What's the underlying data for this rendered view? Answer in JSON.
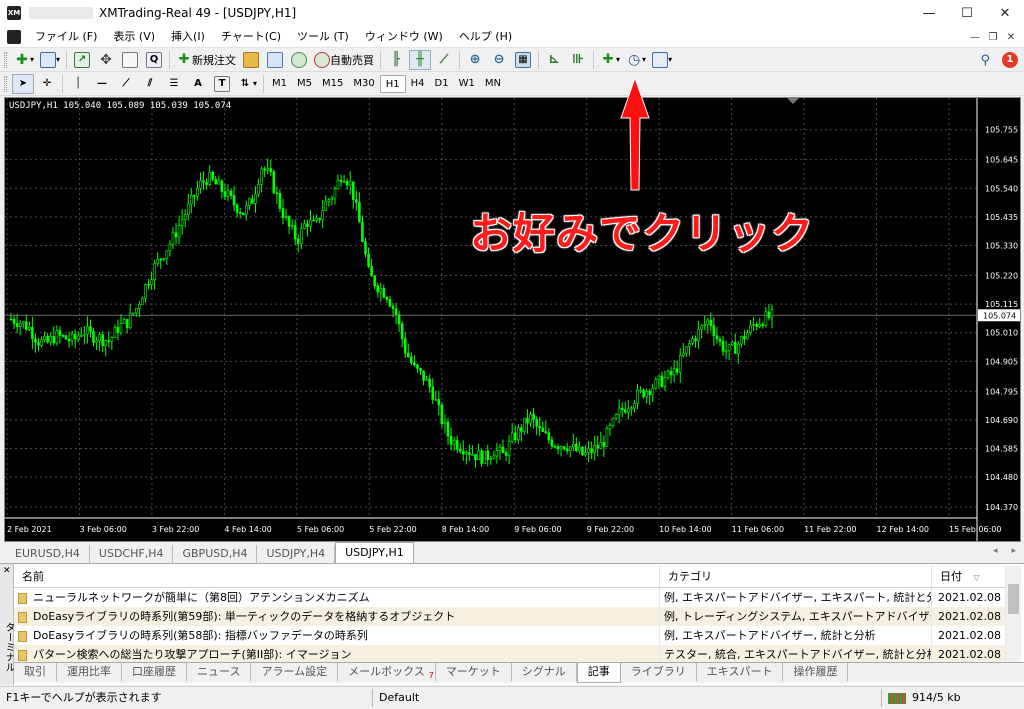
{
  "window": {
    "title": "XMTrading-Real 49 - [USDJPY,H1]",
    "minimize": "—",
    "maximize": "☐",
    "close": "✕"
  },
  "menu": [
    "ファイル (F)",
    "表示 (V)",
    "挿入(I)",
    "チャート(C)",
    "ツール (T)",
    "ウィンドウ (W)",
    "ヘルプ (H)"
  ],
  "toolbar": {
    "new_order": "新規注文",
    "auto_trade": "自動売買"
  },
  "timeframes": [
    "M1",
    "M5",
    "M15",
    "M30",
    "H1",
    "H4",
    "D1",
    "W1",
    "MN"
  ],
  "active_timeframe": "H1",
  "chart": {
    "info": "USDJPY,H1  105.040 105.089 105.039 105.074",
    "current_price": "105.074"
  },
  "chart_data": {
    "type": "candlestick",
    "symbol": "USDJPY",
    "timeframe": "H1",
    "ylim": [
      104.33,
      105.82
    ],
    "y_ticks": [
      "105.755",
      "105.645",
      "105.540",
      "105.435",
      "105.330",
      "105.220",
      "105.115",
      "105.010",
      "104.905",
      "104.795",
      "104.690",
      "104.585",
      "104.480",
      "104.370"
    ],
    "x_ticks": [
      "2 Feb 2021",
      "3 Feb 06:00",
      "3 Feb 22:00",
      "4 Feb 14:00",
      "5 Feb 06:00",
      "5 Feb 22:00",
      "8 Feb 14:00",
      "9 Feb 06:00",
      "9 Feb 22:00",
      "10 Feb 14:00",
      "11 Feb 06:00",
      "11 Feb 22:00",
      "12 Feb 14:00",
      "15 Feb 06:00"
    ],
    "close_series": [
      105.06,
      105.05,
      105.03,
      104.98,
      104.97,
      105.0,
      104.99,
      104.98,
      105.02,
      105.0,
      104.99,
      104.98,
      105.03,
      105.05,
      105.1,
      105.18,
      105.25,
      105.3,
      105.35,
      105.42,
      105.48,
      105.55,
      105.58,
      105.55,
      105.52,
      105.48,
      105.45,
      105.5,
      105.62,
      105.58,
      105.48,
      105.4,
      105.35,
      105.42,
      105.4,
      105.48,
      105.52,
      105.6,
      105.55,
      105.4,
      105.22,
      105.18,
      105.15,
      105.08,
      104.95,
      104.88,
      104.85,
      104.8,
      104.7,
      104.62,
      104.6,
      104.58,
      104.56,
      104.55,
      104.58,
      104.56,
      104.62,
      104.66,
      104.7,
      104.65,
      104.62,
      104.6,
      104.6,
      104.58,
      104.56,
      104.58,
      104.6,
      104.66,
      104.72,
      104.75,
      104.78,
      104.8,
      104.82,
      104.84,
      104.86,
      104.92,
      104.98,
      105.02,
      105.06,
      104.98,
      104.94,
      104.96,
      105.0,
      105.04,
      105.06,
      105.07
    ]
  },
  "overlay_text": "お好みでクリック",
  "chart_tabs": [
    "EURUSD,H4",
    "USDCHF,H4",
    "GBPUSD,H4",
    "USDJPY,H4",
    "USDJPY,H1"
  ],
  "active_chart_tab": "USDJPY,H1",
  "terminal": {
    "side_label": "ターミナル",
    "columns": [
      "名前",
      "カテゴリ",
      "日付"
    ],
    "rows": [
      {
        "name": "ニューラルネットワークが簡単に（第8回）アテンションメカニズム",
        "category": "例, エキスパートアドバイザー, エキスパート, 統計と分析",
        "date": "2021.02.08"
      },
      {
        "name": "DoEasyライブラリの時系列(第59部): 単一ティックのデータを格納するオブジェクト",
        "category": "例, トレーディングシステム, エキスパートアドバイザー, 統計と分析",
        "date": "2021.02.08"
      },
      {
        "name": "DoEasyライブラリの時系列(第58部): 指標バッファデータの時系列",
        "category": "例, エキスパートアドバイザー, 統計と分析",
        "date": "2021.02.08"
      },
      {
        "name": "パターン検索への総当たり攻撃アプローチ(第II部): イマージョン",
        "category": "テスター, 統合, エキスパートアドバイザー, 統計と分析",
        "date": "2021.02.08"
      }
    ],
    "tabs": [
      "取引",
      "運用比率",
      "口座履歴",
      "ニュース",
      "アラーム設定",
      "メールボックス",
      "マーケット",
      "シグナル",
      "記事",
      "ライブラリ",
      "エキスパート",
      "操作履歴"
    ],
    "mailbox_badge": "7",
    "active_tab": "記事"
  },
  "status": {
    "help": "F1キーでヘルプが表示されます",
    "profile": "Default",
    "traffic": "914/5 kb"
  },
  "colors": {
    "candle": "#00ff00",
    "grid": "#4a4a4a",
    "arrow": "#ff1010"
  }
}
